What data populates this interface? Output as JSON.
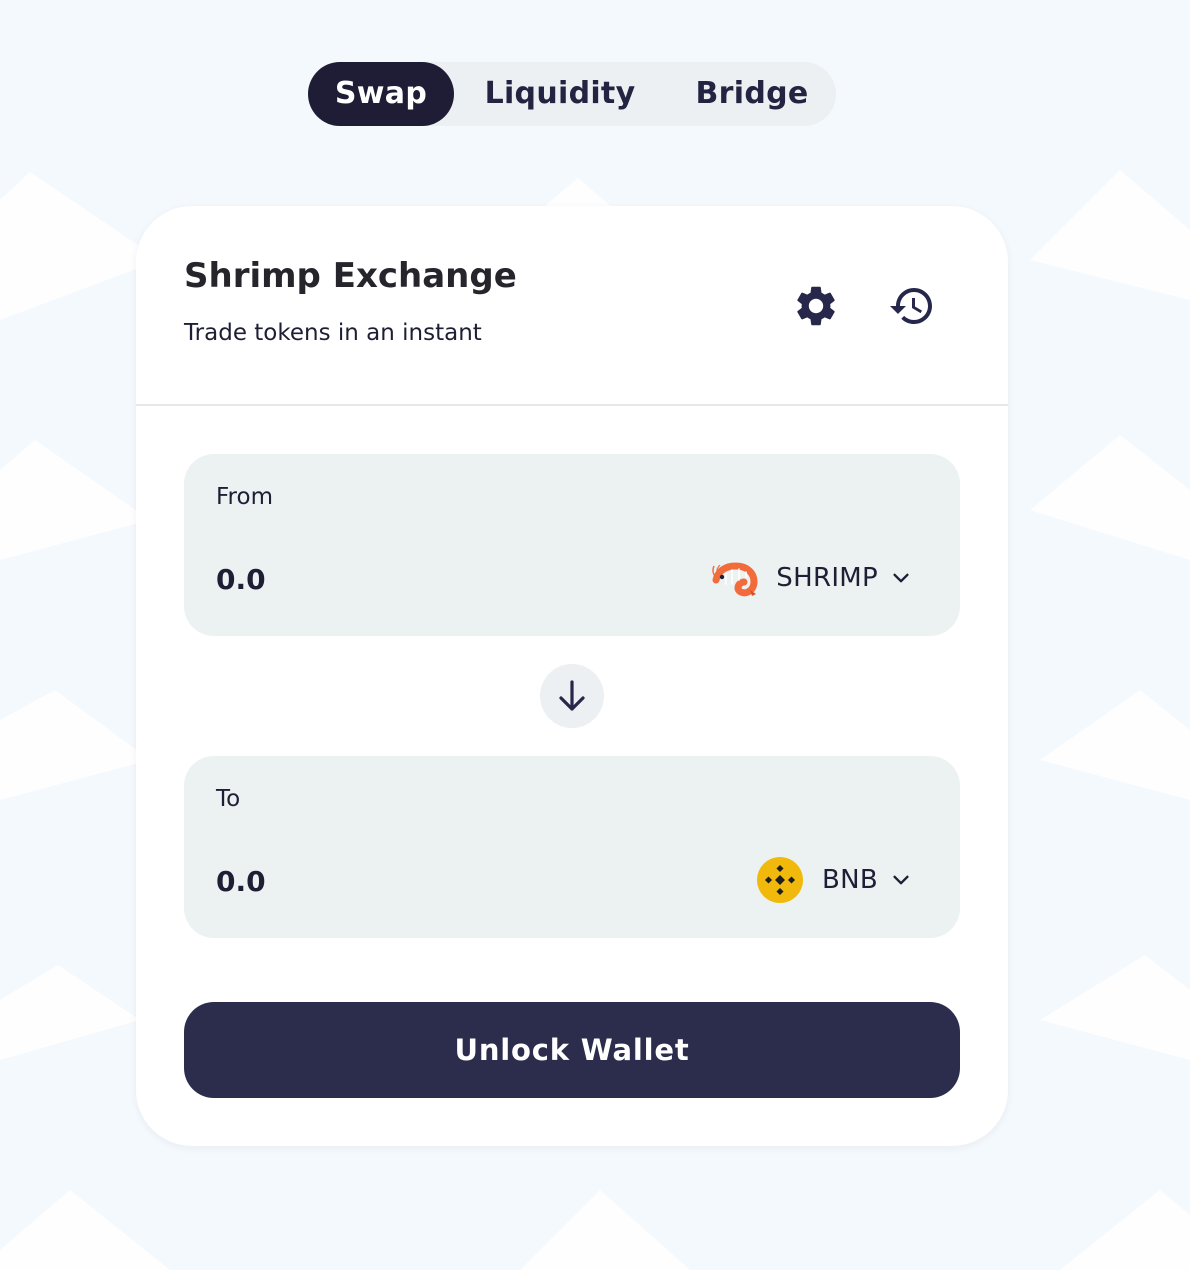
{
  "tabs": [
    {
      "label": "Swap",
      "active": true
    },
    {
      "label": "Liquidity",
      "active": false
    },
    {
      "label": "Bridge",
      "active": false
    }
  ],
  "card": {
    "title": "Shrimp Exchange",
    "subtitle": "Trade tokens in an instant",
    "icons": {
      "settings": "gear-icon",
      "history": "history-icon"
    }
  },
  "from": {
    "label": "From",
    "amount_placeholder": "0.0",
    "amount_value": "",
    "token": {
      "symbol": "SHRIMP",
      "icon": "shrimp-token-icon"
    }
  },
  "switch": {
    "icon": "arrow-down-icon"
  },
  "to": {
    "label": "To",
    "amount_placeholder": "0.0",
    "amount_value": "",
    "token": {
      "symbol": "BNB",
      "icon": "bnb-token-icon"
    }
  },
  "action": {
    "label": "Unlock Wallet"
  },
  "colors": {
    "page_background": "#f4f9fd",
    "active_tab": "#1e1d35",
    "tab_track": "#ecf0f2",
    "card": "#ffffff",
    "input_box": "#ecf1f2",
    "primary_button": "#2c2c4d",
    "bnb": "#f0b90b",
    "shrimp": "#f26b3a"
  }
}
